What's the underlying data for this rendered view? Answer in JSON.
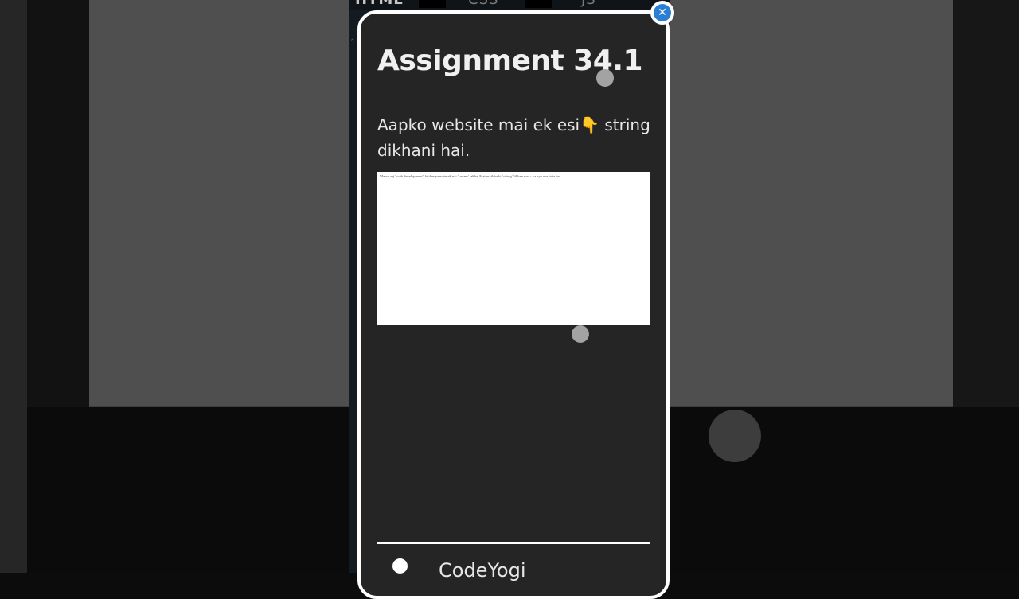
{
  "editor": {
    "tabs": [
      "HTML",
      "CSS",
      "JS"
    ],
    "line_number": "1"
  },
  "modal": {
    "title": "Assignment 34.1",
    "description": "Aapko website mai ek esi👇 string dikhani hai.",
    "preview_text": "Maine aaj \"web development\" ki duniya mein ek nai 'kadam' rakha. Maine sikha ki `string` likhne mai - ka kya use hota hai.",
    "brand": "CodeYogi",
    "close_icon": "close-icon",
    "accent_color": "#2a7fd4"
  }
}
